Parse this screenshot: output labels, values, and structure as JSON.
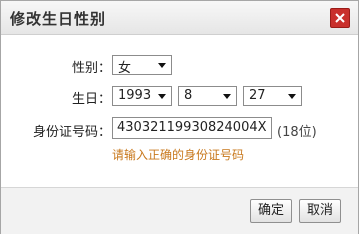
{
  "dialog": {
    "title": "修改生日性别",
    "close_icon": "close-icon"
  },
  "gender": {
    "label": "性别：",
    "value": "女"
  },
  "birthday": {
    "label": "生日：",
    "year": "1993",
    "month": "8",
    "day": "27"
  },
  "id_card": {
    "label": "身份证号码：",
    "value": "43032119930824004X",
    "length_hint": "(18位)",
    "error": "请输入正确的身份证号码"
  },
  "buttons": {
    "confirm": "确定",
    "cancel": "取消"
  },
  "colors": {
    "close_button": "#c9302c",
    "error_text": "#c8781c"
  }
}
